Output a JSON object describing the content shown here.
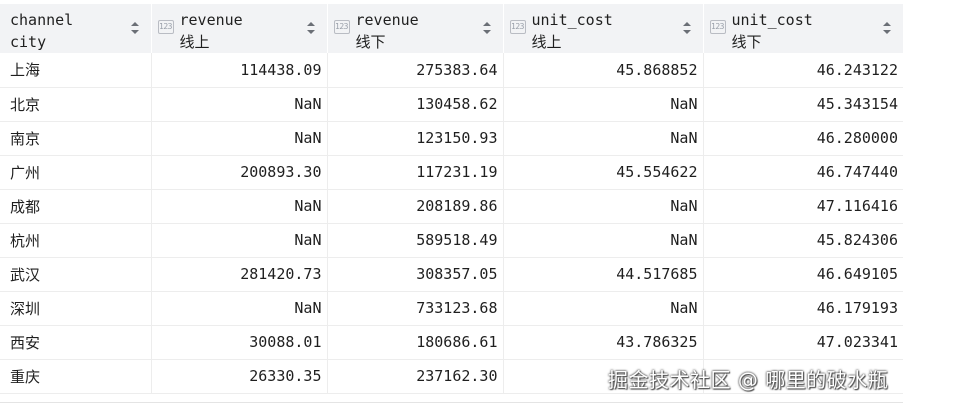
{
  "table": {
    "index_header": {
      "line1": "channel",
      "line2": "city"
    },
    "columns": [
      {
        "line1": "revenue",
        "line2": "线上",
        "type_icon": "123"
      },
      {
        "line1": "revenue",
        "line2": "线下",
        "type_icon": "123"
      },
      {
        "line1": "unit_cost",
        "line2": "线上",
        "type_icon": "123"
      },
      {
        "line1": "unit_cost",
        "line2": "线下",
        "type_icon": "123"
      }
    ],
    "rows": [
      {
        "city": "上海",
        "values": [
          "114438.09",
          "275383.64",
          "45.868852",
          "46.243122"
        ]
      },
      {
        "city": "北京",
        "values": [
          "NaN",
          "130458.62",
          "NaN",
          "45.343154"
        ]
      },
      {
        "city": "南京",
        "values": [
          "NaN",
          "123150.93",
          "NaN",
          "46.280000"
        ]
      },
      {
        "city": "广州",
        "values": [
          "200893.30",
          "117231.19",
          "45.554622",
          "46.747440"
        ]
      },
      {
        "city": "成都",
        "values": [
          "NaN",
          "208189.86",
          "NaN",
          "47.116416"
        ]
      },
      {
        "city": "杭州",
        "values": [
          "NaN",
          "589518.49",
          "NaN",
          "45.824306"
        ]
      },
      {
        "city": "武汉",
        "values": [
          "281420.73",
          "308357.05",
          "44.517685",
          "46.649105"
        ]
      },
      {
        "city": "深圳",
        "values": [
          "NaN",
          "733123.68",
          "NaN",
          "46.179193"
        ]
      },
      {
        "city": "西安",
        "values": [
          "30088.01",
          "180686.61",
          "43.786325",
          "47.023341"
        ]
      },
      {
        "city": "重庆",
        "values": [
          "26330.35",
          "237162.30",
          "",
          ""
        ]
      }
    ]
  },
  "watermark": "掘金技术社区 @ 哪里的破水瓶"
}
